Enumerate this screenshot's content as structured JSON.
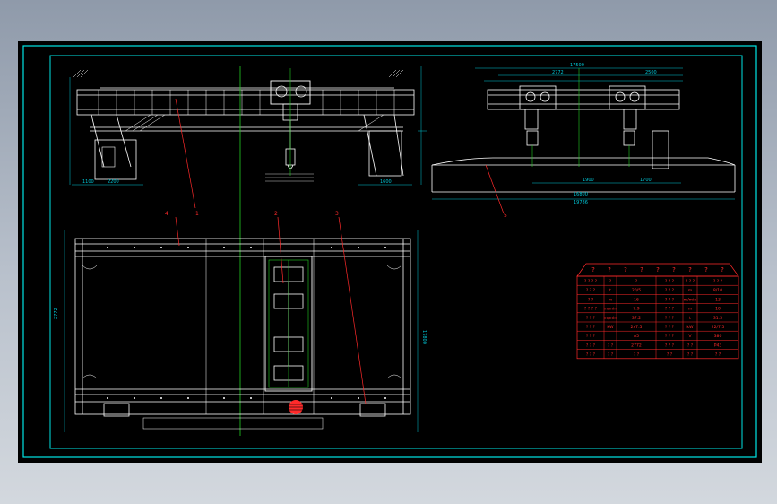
{
  "colors": {
    "background": "#000000",
    "frame": "#00e5e5",
    "geometry": "#ffffff",
    "centerline": "#22cc22",
    "leader": "#ff2a2a",
    "dimension": "#00c8d8",
    "table": "#ff2a2a"
  },
  "labels": {
    "top_span": "17500",
    "top_sub_a": "2772",
    "top_sub_b": "2500",
    "right_bottom_a": "1900",
    "right_bottom_b": "1700",
    "right_total_a": "16800",
    "right_total_b": "19786",
    "left_dim_a": "1100",
    "left_dim_b": "2200",
    "left_dim_c": "1600",
    "plan_gauge": "2772",
    "plan_side": "17800",
    "callout_1": "1",
    "callout_2": "2",
    "callout_3": "3",
    "callout_4": "4",
    "callout_5": "5"
  },
  "title_block": {
    "header_marks": [
      "?",
      "?",
      "?",
      "?",
      "?",
      "?",
      "?",
      "?",
      "?"
    ],
    "rows": [
      [
        "? ? ? ?",
        "?",
        "?",
        "? ? ?",
        "? ? ?",
        "? ? ?"
      ],
      [
        "? ? ?",
        "t",
        "20/5",
        "? ? ?",
        "m",
        "8/10"
      ],
      [
        "? ?",
        "m",
        "16",
        "? ? ?",
        "m/min",
        "13"
      ],
      [
        "? ? ? ?",
        "m/min",
        "7.9",
        "? ? ?",
        "m",
        "10"
      ],
      [
        "? ? ?",
        "m/min",
        "37.2",
        "? ? ?",
        "t",
        "31.5"
      ],
      [
        "? ? ?",
        "kW",
        "2x7.5",
        "? ? ?",
        "kW",
        "22/7.5"
      ],
      [
        "? ? ?",
        "",
        "A5",
        "? ? ?",
        "V",
        "380"
      ],
      [
        "? ? ?",
        "? ?",
        "2772",
        "? ? ?",
        "? ?",
        "P43"
      ],
      [
        "? ? ?",
        "? ?",
        "? ?",
        "? ?",
        "? ?",
        "? ?"
      ]
    ]
  }
}
